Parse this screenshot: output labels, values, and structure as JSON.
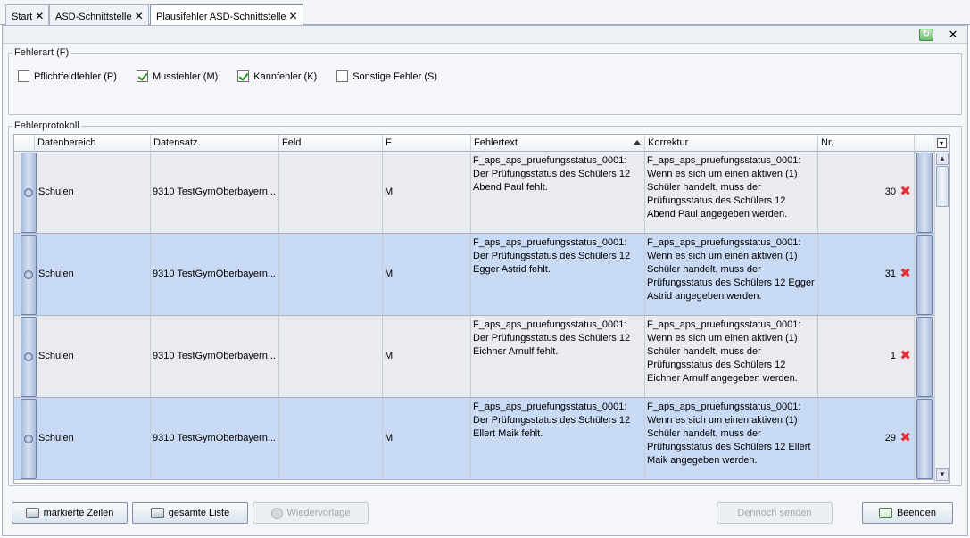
{
  "tabs": [
    {
      "label": "Start",
      "close": "✕"
    },
    {
      "label": "ASD-Schnittstelle",
      "close": "✕"
    },
    {
      "label": "Plausifehler ASD-Schnittstelle",
      "close": "✕"
    }
  ],
  "toolbar": {
    "refresh_icon": "refresh-icon",
    "close_glyph": "✕"
  },
  "fehlerart": {
    "legend": "Fehlerart (F)",
    "options": [
      {
        "label": "Pflichtfeldfehler (P)",
        "checked": false
      },
      {
        "label": "Mussfehler (M)",
        "checked": true
      },
      {
        "label": "Kannfehler (K)",
        "checked": true
      },
      {
        "label": "Sonstige Fehler (S)",
        "checked": false
      }
    ]
  },
  "protokoll": {
    "legend": "Fehlerprotokoll",
    "columns": [
      "Datenbereich",
      "Datensatz",
      "Feld",
      "F",
      "Fehlertext",
      "Korrektur",
      "Nr."
    ],
    "sorted_column": "Fehlertext",
    "rows": [
      {
        "datenbereich": "Schulen",
        "datensatz": "9310 TestGymOberbayern...",
        "feld": "",
        "f": "M",
        "fehlertext": "F_aps_aps_pruefungsstatus_0001: Der Prüfungsstatus des Schülers 12 Abend Paul fehlt.",
        "korrektur": "F_aps_aps_pruefungsstatus_0001: Wenn es sich um einen aktiven (1) Schüler handelt, muss der Prüfungsstatus des Schülers 12 Abend Paul angegeben werden.",
        "nr": "30"
      },
      {
        "datenbereich": "Schulen",
        "datensatz": "9310 TestGymOberbayern...",
        "feld": "",
        "f": "M",
        "fehlertext": "F_aps_aps_pruefungsstatus_0001: Der Prüfungsstatus des Schülers 12 Egger Astrid fehlt.",
        "korrektur": "F_aps_aps_pruefungsstatus_0001: Wenn es sich um einen aktiven (1) Schüler handelt, muss der Prüfungsstatus des Schülers 12 Egger Astrid angegeben werden.",
        "nr": "31"
      },
      {
        "datenbereich": "Schulen",
        "datensatz": "9310 TestGymOberbayern...",
        "feld": "",
        "f": "M",
        "fehlertext": "F_aps_aps_pruefungsstatus_0001: Der Prüfungsstatus des Schülers 12 Eichner Arnulf fehlt.",
        "korrektur": "F_aps_aps_pruefungsstatus_0001: Wenn es sich um einen aktiven (1) Schüler handelt, muss der Prüfungsstatus des Schülers 12 Eichner Arnulf angegeben werden.",
        "nr": "1"
      },
      {
        "datenbereich": "Schulen",
        "datensatz": "9310 TestGymOberbayern...",
        "feld": "",
        "f": "M",
        "fehlertext": "F_aps_aps_pruefungsstatus_0001: Der Prüfungsstatus des Schülers 12 Ellert Maik fehlt.",
        "korrektur": "F_aps_aps_pruefungsstatus_0001: Wenn es sich um einen aktiven (1) Schüler handelt, muss der Prüfungsstatus des Schülers 12 Ellert Maik angegeben werden.",
        "nr": "29"
      }
    ],
    "delete_glyph": "✖"
  },
  "buttons": {
    "markierte_zeilen": "markierte Zeilen",
    "gesamte_liste": "gesamte Liste",
    "wiedervorlage": "Wiedervorlage",
    "dennoch_senden": "Dennoch senden",
    "beenden": "Beenden"
  },
  "colors": {
    "row_odd": "#e9ebf0",
    "row_even": "#c9daf5",
    "delete": "#e0303a"
  }
}
